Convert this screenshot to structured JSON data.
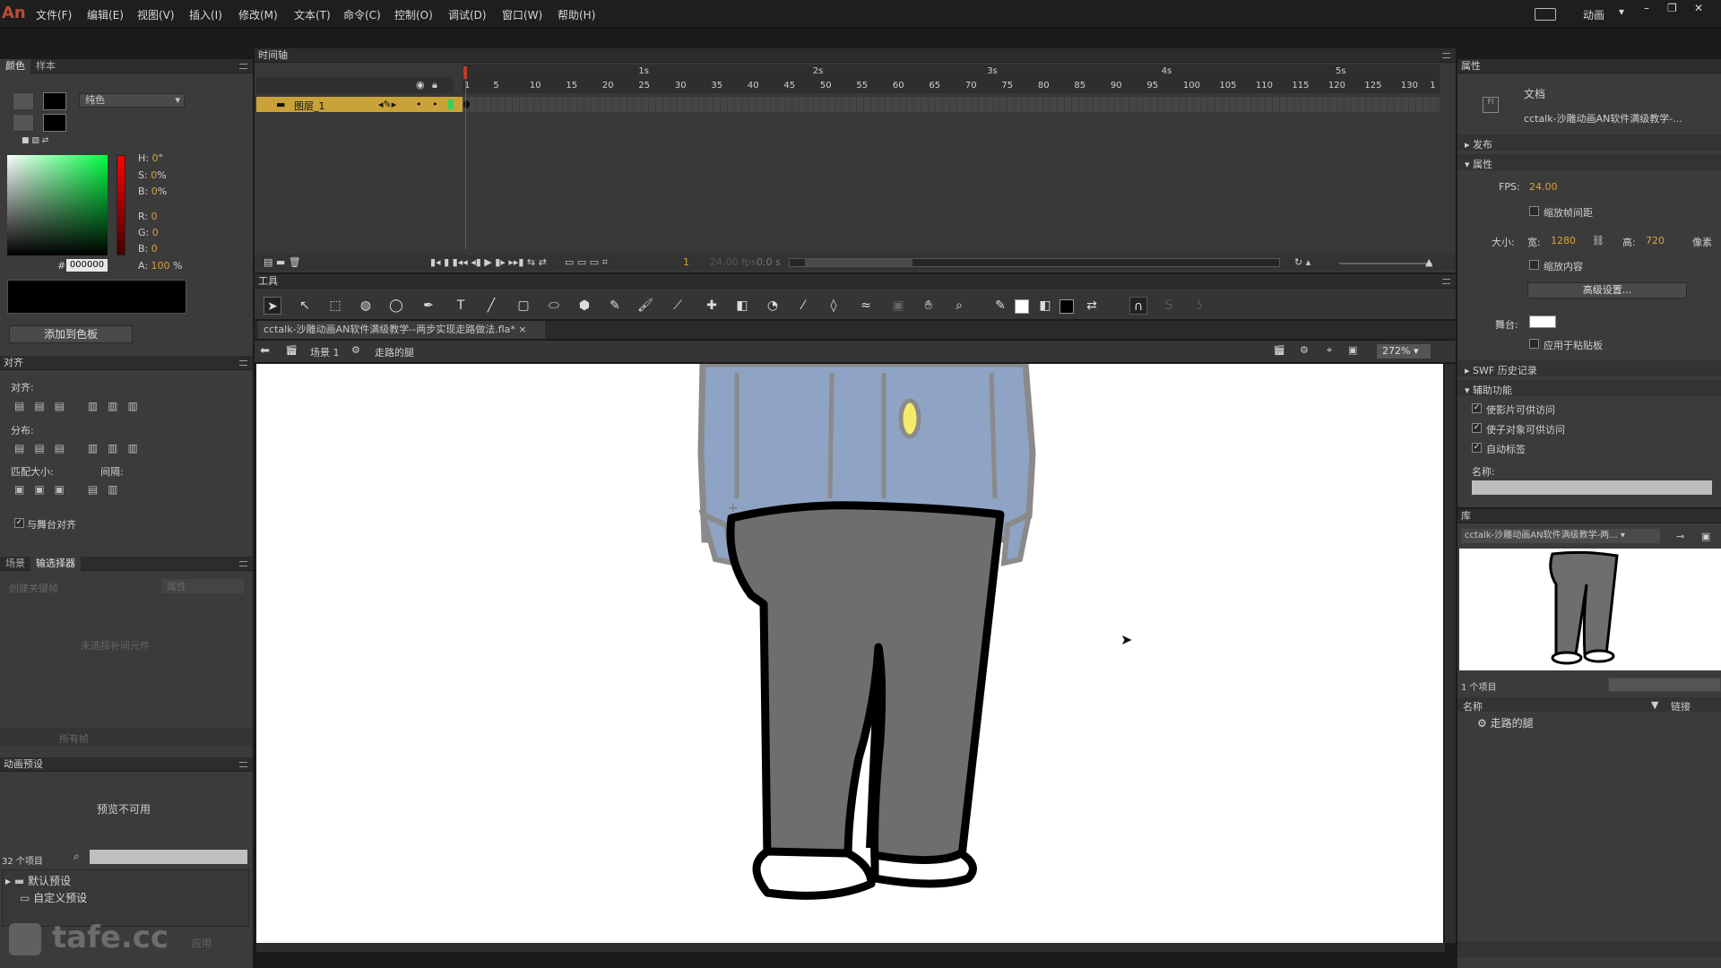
{
  "menu": {
    "logo": "An",
    "items": [
      "文件(F)",
      "编辑(E)",
      "视图(V)",
      "插入(I)",
      "修改(M)",
      "文本(T)",
      "命令(C)",
      "控制(O)",
      "调试(D)",
      "窗口(W)",
      "帮助(H)"
    ],
    "workspace": "动画"
  },
  "color_panel": {
    "tabs": [
      "颜色",
      "样本"
    ],
    "fill_type": "纯色",
    "h_label": "H:",
    "h_value": "0",
    "h_unit": "°",
    "s_label": "S:",
    "s_value": "0",
    "s_unit": "%",
    "b_label": "B:",
    "b_value": "0",
    "b_unit": "%",
    "r_label": "R:",
    "r_value": "0",
    "g_label": "G:",
    "g_value": "0",
    "bl_label": "B:",
    "bl_value": "0",
    "hex_label": "#",
    "hex_value": "000000",
    "a_label": "A:",
    "a_value": "100",
    "a_unit": "%",
    "add_button": "添加到色板"
  },
  "align_panel": {
    "title": "对齐",
    "align_label": "对齐:",
    "distribute_label": "分布:",
    "match_label": "匹配大小:",
    "spacing_label": "间隔:",
    "stage_checkbox": "与舞台对齐",
    "stage_checked": true
  },
  "scene_panel": {
    "tabs": [
      "场景",
      "输选择器"
    ],
    "item1": "创建关键帧",
    "item2": "属性",
    "empty_text": "未选择补间元件",
    "dropdown": "所有帧"
  },
  "presets_panel": {
    "title": "动画预设",
    "preview_text": "预览不可用",
    "count": "32 个项目",
    "folders": [
      "默认预设",
      "自定义预设"
    ],
    "button": "应用"
  },
  "timeline": {
    "title": "时间轴",
    "layer_name": "图层_1",
    "ruler_labels": [
      "1",
      "5",
      "10",
      "15",
      "20",
      "25",
      "30",
      "35",
      "40",
      "45",
      "50",
      "55",
      "60",
      "65",
      "70",
      "75",
      "80",
      "85",
      "90",
      "95",
      "100",
      "105",
      "110",
      "115",
      "120",
      "125",
      "130",
      "1"
    ],
    "seconds": [
      "1s",
      "2s",
      "3s",
      "4s",
      "5s"
    ],
    "frame_display": "1",
    "fps_display": "24.00 fps",
    "time_display": "0.0 s"
  },
  "tools": {
    "title": "工具"
  },
  "document": {
    "tab_title": "cctalk-沙雕动画AN软件满级教学--两步实现走路做法.fla*",
    "scene_label": "场景 1",
    "symbol_label": "走路的腿",
    "zoom": "272%"
  },
  "properties": {
    "title": "属性",
    "doc_type": "文档",
    "doc_name": "cctalk-沙雕动画AN软件满级教学-...",
    "sec_publish": "发布",
    "sec_props": "属性",
    "fps_label": "FPS:",
    "fps_value": "24.00",
    "scale_spacing": "缩放帧间距",
    "size_label": "大小:",
    "width_label": "宽:",
    "width_value": "1280",
    "height_label": "高:",
    "height_value": "720",
    "unit": "像素",
    "scale_content": "缩放内容",
    "advanced_button": "高级设置...",
    "stage_label": "舞台:",
    "apply_pasteboard": "应用于粘贴板",
    "sec_swf": "SWF 历史记录",
    "sec_access": "辅助功能",
    "access1": "使影片可供访问",
    "access2": "使子对象可供访问",
    "access3": "自动标签",
    "name_label": "名称:"
  },
  "library": {
    "title": "库",
    "doc_select": "cctalk-沙雕动画AN软件满级教学-两...",
    "count": "1 个项目",
    "col_name": "名称",
    "col_link": "链接",
    "item": "走路的腿"
  },
  "watermark": "tafe.cc",
  "colors": {
    "stage_bg": "#ffffff",
    "pants": "#6e6e6e",
    "shirt": "#8fa3c4",
    "button": "#f5ea6a",
    "playhead": "#c0392b"
  }
}
